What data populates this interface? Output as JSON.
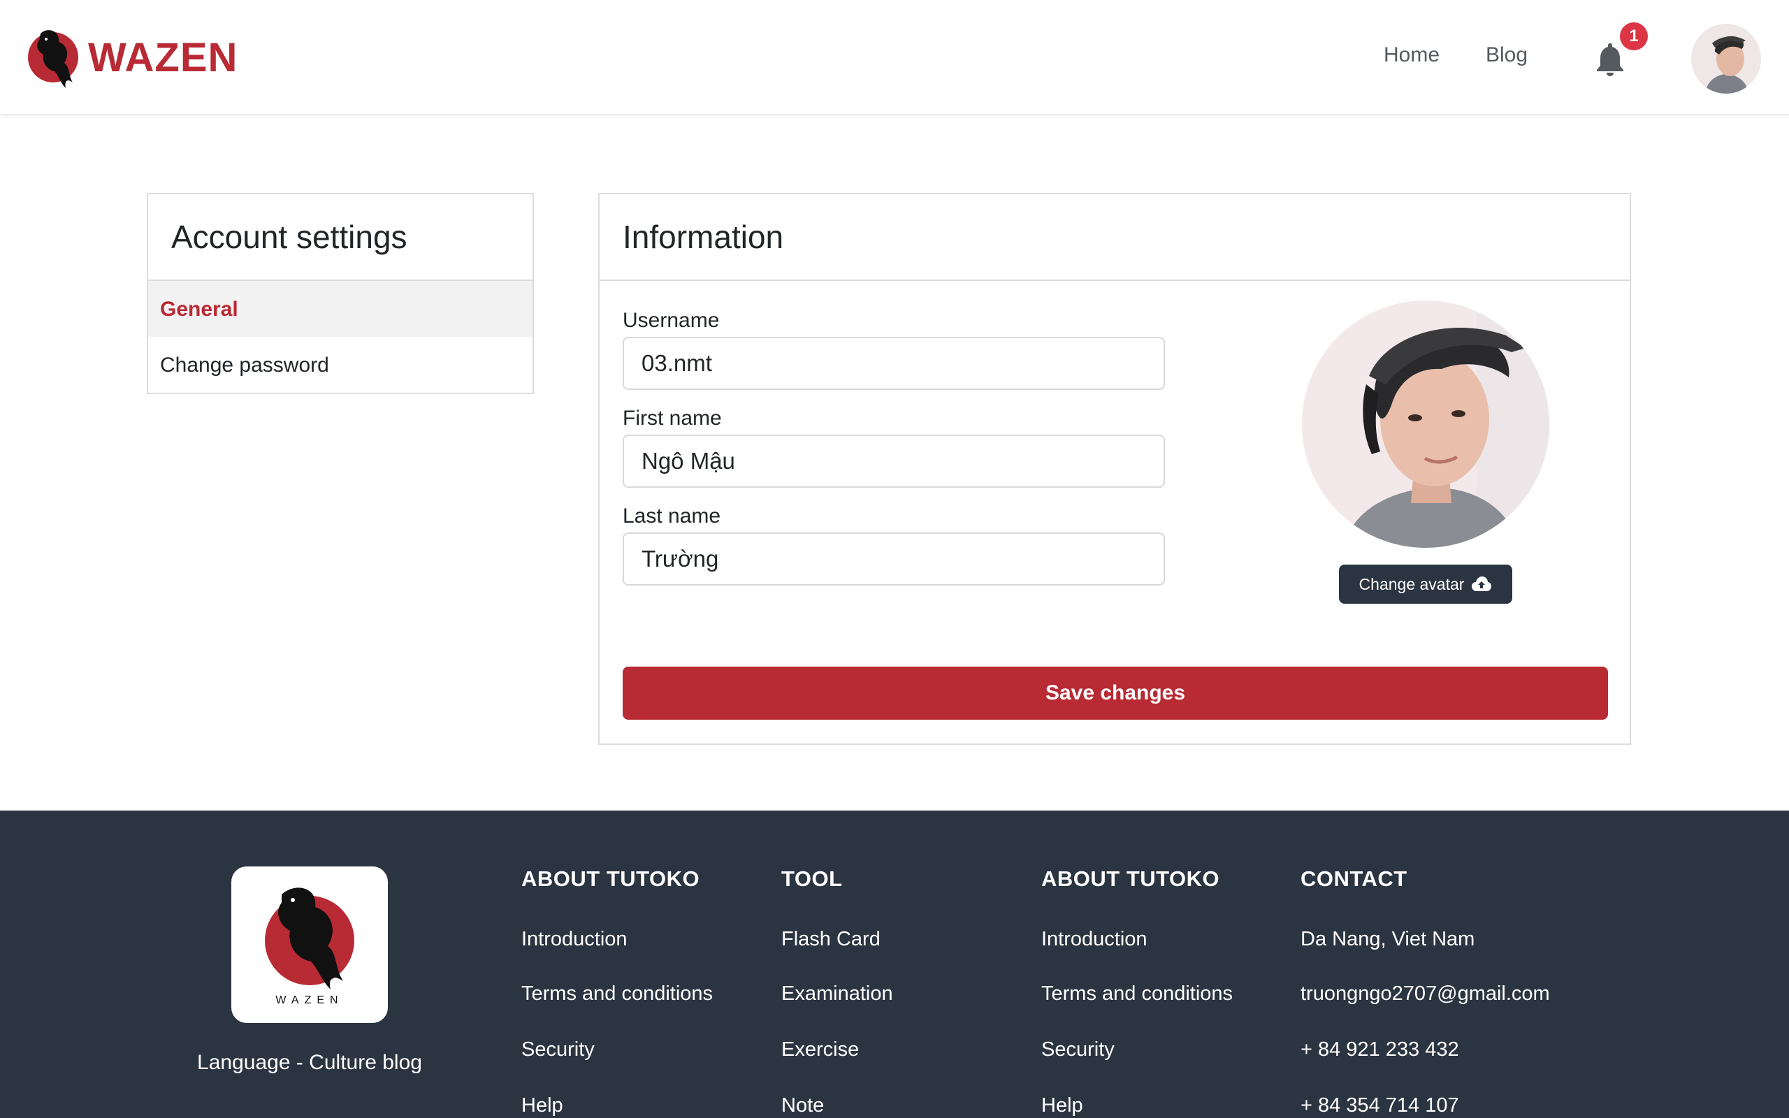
{
  "brand": {
    "name": "WAZEN",
    "color": "#b82a34"
  },
  "nav": {
    "home": "Home",
    "blog": "Blog",
    "notification_count": "1"
  },
  "sidebar": {
    "title": "Account settings",
    "items": [
      {
        "label": "General",
        "active": true
      },
      {
        "label": "Change password",
        "active": false
      }
    ]
  },
  "info": {
    "title": "Information",
    "username": {
      "label": "Username",
      "value": "03.nmt"
    },
    "first_name": {
      "label": "First name",
      "value": "Ngô Mậu"
    },
    "last_name": {
      "label": "Last name",
      "value": "Trường"
    },
    "change_avatar_label": "Change avatar",
    "save_label": "Save changes"
  },
  "footer": {
    "logo_text": "WAZEN",
    "tagline": "Language - Culture blog",
    "columns": [
      {
        "title": "ABOUT TUTOKO",
        "items": [
          "Introduction",
          "Terms and conditions",
          "Security",
          "Help"
        ]
      },
      {
        "title": "TOOL",
        "items": [
          "Flash Card",
          "Examination",
          "Exercise",
          "Note"
        ]
      },
      {
        "title": "ABOUT TUTOKO",
        "items": [
          "Introduction",
          "Terms and conditions",
          "Security",
          "Help"
        ]
      },
      {
        "title": "CONTACT",
        "items": [
          "Da Nang, Viet Nam",
          "truongngo2707@gmail.com",
          "+ 84 921 233 432",
          "+ 84 354 714 107"
        ]
      }
    ]
  },
  "colors": {
    "accent": "#b82a34",
    "dark": "#2b3441",
    "badge": "#dc3545"
  }
}
